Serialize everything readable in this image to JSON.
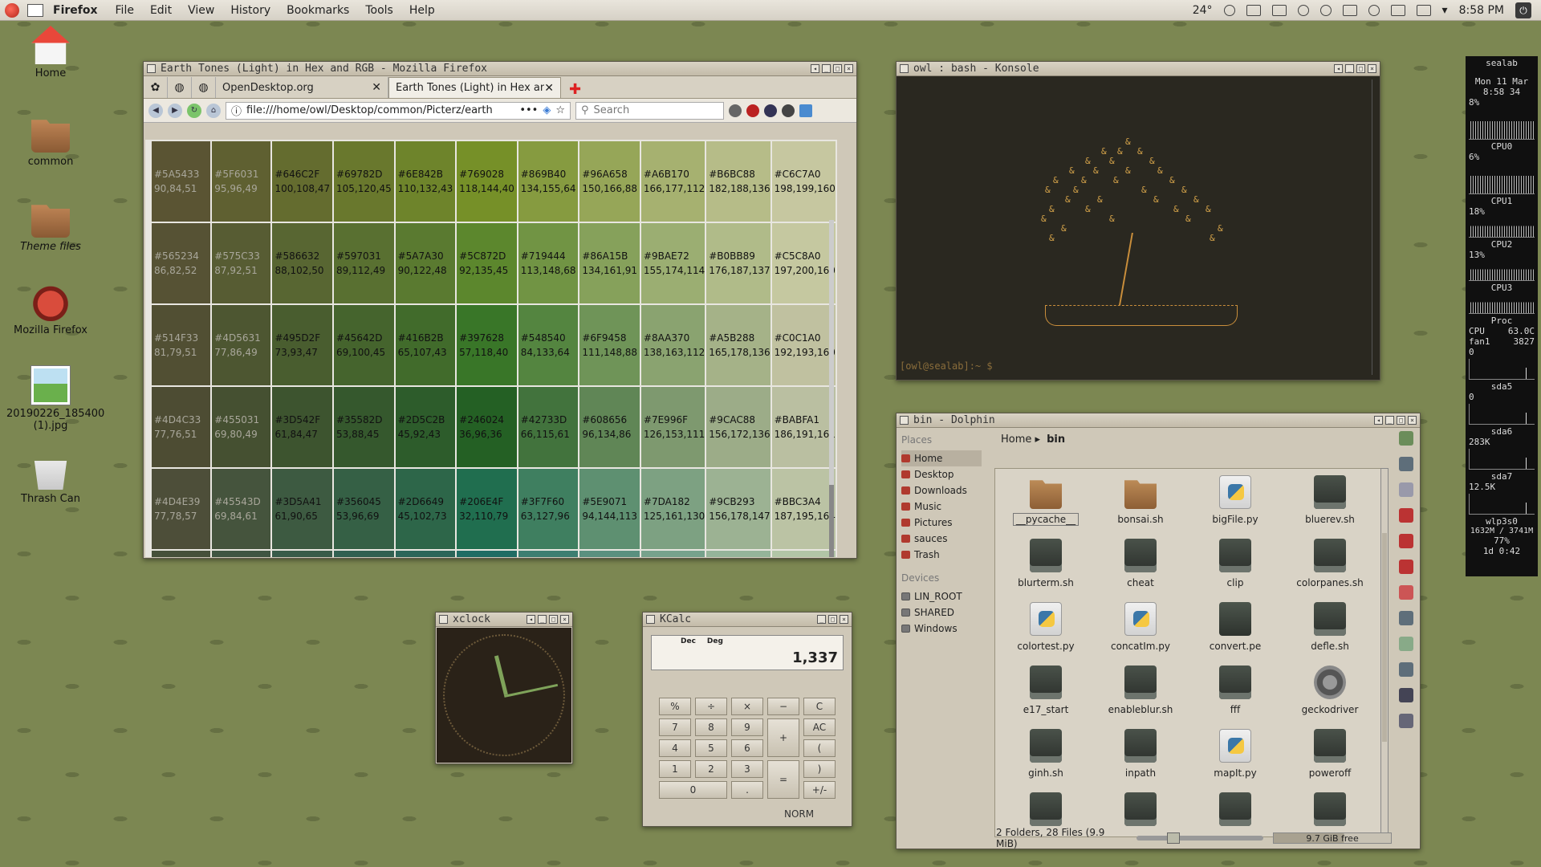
{
  "top_panel": {
    "app_name": "Firefox",
    "menus": [
      "File",
      "Edit",
      "View",
      "History",
      "Bookmarks",
      "Tools",
      "Help"
    ],
    "temperature": "24°",
    "time": "8:58 PM"
  },
  "desktop_icons": [
    {
      "label": "Home",
      "icon": "home-icon"
    },
    {
      "label": "common",
      "icon": "folder-icon"
    },
    {
      "label": "Theme files",
      "icon": "folder-icon"
    },
    {
      "label": "Mozilla Firefox",
      "icon": "firefox-icon"
    },
    {
      "label": "20190226_185400 (1).jpg",
      "icon": "image-file-icon"
    },
    {
      "label": "Thrash Can",
      "icon": "trash-icon"
    }
  ],
  "firefox": {
    "title": "Earth Tones (Light) in Hex and RGB - Mozilla Firefox",
    "tabs": [
      {
        "label": "OpenDesktop.org",
        "active": false
      },
      {
        "label": "Earth Tones (Light) in Hex and R",
        "active": true
      }
    ],
    "url": "file:///home/owl/Desktop/common/Picterz/earth",
    "url_more": "•••",
    "search_placeholder": "Search",
    "color_rows": [
      [
        {
          "hex": "#5A5433",
          "rgb": "90,84,51",
          "color": "#5A5433"
        },
        {
          "hex": "#5F6031",
          "rgb": "95,96,49",
          "color": "#5F6031"
        },
        {
          "hex": "#646C2F",
          "rgb": "100,108,47",
          "color": "#646C2F"
        },
        {
          "hex": "#69782D",
          "rgb": "105,120,45",
          "color": "#69782D"
        },
        {
          "hex": "#6E842B",
          "rgb": "110,132,43",
          "color": "#6E842B"
        },
        {
          "hex": "#769028",
          "rgb": "118,144,40",
          "color": "#769028"
        },
        {
          "hex": "#869B40",
          "rgb": "134,155,64",
          "color": "#869B40"
        },
        {
          "hex": "#96A658",
          "rgb": "150,166,88",
          "color": "#96A658"
        },
        {
          "hex": "#A6B170",
          "rgb": "166,177,112",
          "color": "#A6B170"
        },
        {
          "hex": "#B6BC88",
          "rgb": "182,188,136",
          "color": "#B6BC88"
        },
        {
          "hex": "#C6C7A0",
          "rgb": "198,199,160",
          "color": "#C6C7A0"
        }
      ],
      [
        {
          "hex": "#565234",
          "rgb": "86,82,52",
          "color": "#565234"
        },
        {
          "hex": "#575C33",
          "rgb": "87,92,51",
          "color": "#575C33"
        },
        {
          "hex": "#586632",
          "rgb": "88,102,50",
          "color": "#586632"
        },
        {
          "hex": "#597031",
          "rgb": "89,112,49",
          "color": "#597031"
        },
        {
          "hex": "#5A7A30",
          "rgb": "90,122,48",
          "color": "#5A7A30"
        },
        {
          "hex": "#5C872D",
          "rgb": "92,135,45",
          "color": "#5C872D"
        },
        {
          "hex": "#719444",
          "rgb": "113,148,68",
          "color": "#719444"
        },
        {
          "hex": "#86A15B",
          "rgb": "134,161,91",
          "color": "#86A15B"
        },
        {
          "hex": "#9BAE72",
          "rgb": "155,174,114",
          "color": "#9BAE72"
        },
        {
          "hex": "#B0BB89",
          "rgb": "176,187,137",
          "color": "#B0BB89"
        },
        {
          "hex": "#C5C8A0",
          "rgb": "197,200,160",
          "color": "#C5C8A0"
        }
      ],
      [
        {
          "hex": "#514F33",
          "rgb": "81,79,51",
          "color": "#514F33"
        },
        {
          "hex": "#4D5631",
          "rgb": "77,86,49",
          "color": "#4D5631"
        },
        {
          "hex": "#495D2F",
          "rgb": "73,93,47",
          "color": "#495D2F"
        },
        {
          "hex": "#45642D",
          "rgb": "69,100,45",
          "color": "#45642D"
        },
        {
          "hex": "#416B2B",
          "rgb": "65,107,43",
          "color": "#416B2B"
        },
        {
          "hex": "#397628",
          "rgb": "57,118,40",
          "color": "#397628"
        },
        {
          "hex": "#548540",
          "rgb": "84,133,64",
          "color": "#548540"
        },
        {
          "hex": "#6F9458",
          "rgb": "111,148,88",
          "color": "#6F9458"
        },
        {
          "hex": "#8AA370",
          "rgb": "138,163,112",
          "color": "#8AA370"
        },
        {
          "hex": "#A5B288",
          "rgb": "165,178,136",
          "color": "#A5B288"
        },
        {
          "hex": "#C0C1A0",
          "rgb": "192,193,160",
          "color": "#C0C1A0"
        }
      ],
      [
        {
          "hex": "#4D4C33",
          "rgb": "77,76,51",
          "color": "#4D4C33"
        },
        {
          "hex": "#455031",
          "rgb": "69,80,49",
          "color": "#455031"
        },
        {
          "hex": "#3D542F",
          "rgb": "61,84,47",
          "color": "#3D542F"
        },
        {
          "hex": "#35582D",
          "rgb": "53,88,45",
          "color": "#35582D"
        },
        {
          "hex": "#2D5C2B",
          "rgb": "45,92,43",
          "color": "#2D5C2B"
        },
        {
          "hex": "#246024",
          "rgb": "36,96,36",
          "color": "#246024"
        },
        {
          "hex": "#42733D",
          "rgb": "66,115,61",
          "color": "#42733D"
        },
        {
          "hex": "#608656",
          "rgb": "96,134,86",
          "color": "#608656"
        },
        {
          "hex": "#7E996F",
          "rgb": "126,153,111",
          "color": "#7E996F"
        },
        {
          "hex": "#9CAC88",
          "rgb": "156,172,136",
          "color": "#9CAC88"
        },
        {
          "hex": "#BABFA1",
          "rgb": "186,191,161",
          "color": "#BABFA1"
        }
      ],
      [
        {
          "hex": "#4D4E39",
          "rgb": "77,78,57",
          "color": "#4D4E39"
        },
        {
          "hex": "#45543D",
          "rgb": "69,84,61",
          "color": "#45543D"
        },
        {
          "hex": "#3D5A41",
          "rgb": "61,90,65",
          "color": "#3D5A41"
        },
        {
          "hex": "#356045",
          "rgb": "53,96,69",
          "color": "#356045"
        },
        {
          "hex": "#2D6649",
          "rgb": "45,102,73",
          "color": "#2D6649"
        },
        {
          "hex": "#206E4F",
          "rgb": "32,110,79",
          "color": "#206E4F"
        },
        {
          "hex": "#3F7F60",
          "rgb": "63,127,96",
          "color": "#3F7F60"
        },
        {
          "hex": "#5E9071",
          "rgb": "94,144,113",
          "color": "#5E9071"
        },
        {
          "hex": "#7DA182",
          "rgb": "125,161,130",
          "color": "#7DA182"
        },
        {
          "hex": "#9CB293",
          "rgb": "156,178,147",
          "color": "#9CB293"
        },
        {
          "hex": "#BBC3A4",
          "rgb": "187,195,164",
          "color": "#BBC3A4"
        }
      ]
    ]
  },
  "konsole": {
    "title": "owl : bash - Konsole",
    "prompt": "[owl@sealab]:~ $"
  },
  "dolphin": {
    "title": "bin - Dolphin",
    "places_header": "Places",
    "places": [
      "Home",
      "Desktop",
      "Downloads",
      "Music",
      "Pictures",
      "sauces",
      "Trash"
    ],
    "devices_header": "Devices",
    "devices": [
      "LIN_ROOT",
      "SHARED",
      "Windows"
    ],
    "breadcrumb": [
      "Home",
      "bin"
    ],
    "files": [
      {
        "name": "__pycache__",
        "type": "folder"
      },
      {
        "name": "bonsai.sh",
        "type": "folder"
      },
      {
        "name": "bigFile.py",
        "type": "py"
      },
      {
        "name": "bluerev.sh",
        "type": "script"
      },
      {
        "name": "blurterm.sh",
        "type": "script"
      },
      {
        "name": "cheat",
        "type": "script"
      },
      {
        "name": "clip",
        "type": "script"
      },
      {
        "name": "colorpanes.sh",
        "type": "script"
      },
      {
        "name": "colortest.py",
        "type": "py"
      },
      {
        "name": "concatIm.py",
        "type": "py"
      },
      {
        "name": "convert.pe",
        "type": "doc"
      },
      {
        "name": "defle.sh",
        "type": "script"
      },
      {
        "name": "e17_start",
        "type": "script"
      },
      {
        "name": "enableblur.sh",
        "type": "script"
      },
      {
        "name": "fff",
        "type": "script"
      },
      {
        "name": "geckodriver",
        "type": "gear"
      },
      {
        "name": "ginh.sh",
        "type": "script"
      },
      {
        "name": "inpath",
        "type": "script"
      },
      {
        "name": "mapIt.py",
        "type": "py"
      },
      {
        "name": "poweroff",
        "type": "script"
      },
      {
        "name": "",
        "type": "script"
      },
      {
        "name": "",
        "type": "script"
      },
      {
        "name": "",
        "type": "script"
      },
      {
        "name": "",
        "type": "script"
      }
    ],
    "status": "2 Folders, 28 Files (9.9 MiB)",
    "free_space": "9.7 GiB free",
    "free_space_used_fraction": 0.6,
    "zoom_level_fraction": 0.24
  },
  "xclock": {
    "title": "xclock",
    "hour_angle_deg": 256,
    "minute_angle_deg": 348
  },
  "kcalc": {
    "title": "KCalc",
    "mode_dec": "Dec",
    "mode_deg": "Deg",
    "display": "1,337",
    "keys": [
      "%",
      "÷",
      "×",
      "−",
      "C",
      "7",
      "8",
      "9",
      "+",
      "AC",
      "4",
      "5",
      "6",
      "(",
      "1",
      "2",
      "3",
      "=",
      ")",
      "0",
      ".",
      "+/-"
    ],
    "norm": "NORM"
  },
  "conky": {
    "host": "sealab",
    "date": "Mon 11 Mar",
    "time": "8:58 34",
    "cpu_labels": [
      "CPU0",
      "CPU1",
      "CPU2",
      "CPU3"
    ],
    "cpu_pct": [
      "8%",
      "6%",
      "18%",
      "13%"
    ],
    "proc_label": "Proc",
    "cpu_temp_label": "CPU",
    "cpu_temp": "63.0C",
    "fan_label": "fan1",
    "fan_value": "3827",
    "fan_zero": "0",
    "disks": [
      {
        "name": "sda5",
        "value": "0"
      },
      {
        "name": "sda6",
        "value": "283K"
      },
      {
        "name": "sda7",
        "value": "12.5K"
      }
    ],
    "net_iface": "wlp3s0",
    "memory": "1632M / 3741M",
    "battery": "77%",
    "uptime": "1d 0:42"
  }
}
